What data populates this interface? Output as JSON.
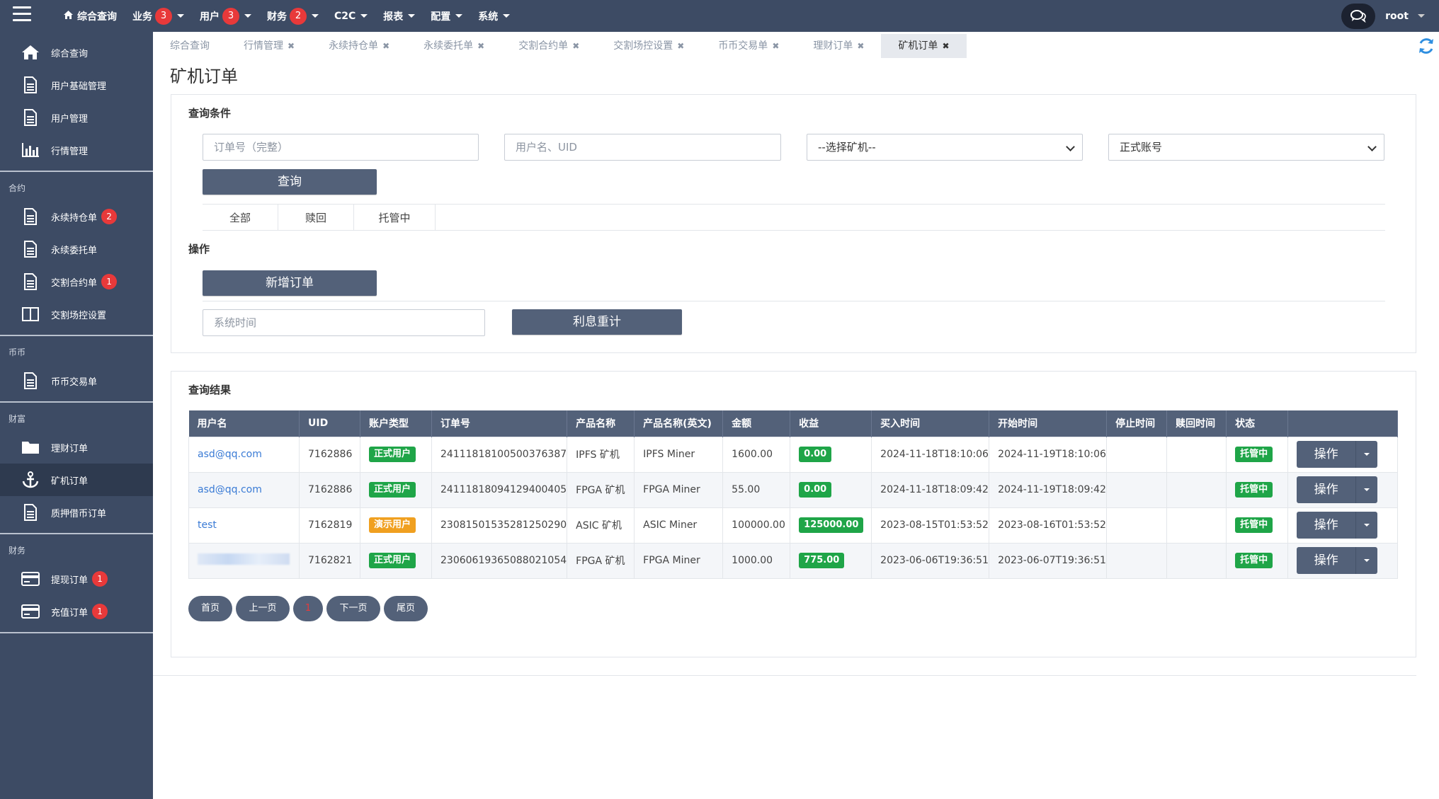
{
  "topnav": {
    "items": [
      {
        "label": "综合查询",
        "badge": ""
      },
      {
        "label": "业务",
        "badge": "3"
      },
      {
        "label": "用户",
        "badge": "3"
      },
      {
        "label": "财务",
        "badge": "2"
      },
      {
        "label": "C2C",
        "badge": ""
      },
      {
        "label": "报表",
        "badge": ""
      },
      {
        "label": "配置",
        "badge": ""
      },
      {
        "label": "系统",
        "badge": ""
      }
    ],
    "user": "root"
  },
  "sidebar": {
    "items": [
      {
        "label": "综合查询",
        "icon": "home-icon"
      },
      {
        "label": "用户基础管理",
        "icon": "document-icon"
      },
      {
        "label": "用户管理",
        "icon": "document-icon"
      },
      {
        "label": "行情管理",
        "icon": "bar-chart-icon"
      }
    ],
    "section_contract": "合约",
    "contract_items": [
      {
        "label": "永续持仓单",
        "badge": "2"
      },
      {
        "label": "永续委托单",
        "badge": ""
      },
      {
        "label": "交割合约单",
        "badge": "1"
      },
      {
        "label": "交割场控设置",
        "badge": ""
      }
    ],
    "section_coin": "币币",
    "coin_items": [
      {
        "label": "币币交易单"
      }
    ],
    "section_wealth": "财富",
    "wealth_items": [
      {
        "label": "理财订单"
      },
      {
        "label": "矿机订单"
      },
      {
        "label": "质押借币订单"
      }
    ],
    "section_finance": "财务",
    "finance_items": [
      {
        "label": "提现订单",
        "badge": "1"
      },
      {
        "label": "充值订单",
        "badge": "1"
      }
    ]
  },
  "tabs": [
    "综合查询",
    "行情管理",
    "永续持仓单",
    "永续委托单",
    "交割合约单",
    "交割场控设置",
    "币币交易单",
    "理财订单",
    "矿机订单"
  ],
  "page_title": "矿机订单",
  "query": {
    "heading": "查询条件",
    "order_placeholder": "订单号（完整）",
    "user_placeholder": "用户名、UID",
    "miner_select": "--选择矿机--",
    "account_select": "正式账号",
    "search_button": "查询",
    "subtabs": [
      "全部",
      "赎回",
      "托管中"
    ],
    "ops_heading": "操作",
    "add_button": "新增订单",
    "systime_placeholder": "系统时间",
    "recalc_button": "利息重计"
  },
  "results": {
    "heading": "查询结果",
    "columns": [
      "用户名",
      "UID",
      "账户类型",
      "订单号",
      "产品名称",
      "产品名称(英文)",
      "金额",
      "收益",
      "买入时间",
      "开始时间",
      "停止时间",
      "赎回时间",
      "状态",
      ""
    ],
    "rows": [
      {
        "user": "asd@qq.com",
        "uid": "7162886",
        "acct": "正式用户",
        "acct_type": "green",
        "order": "24111818100500376387",
        "product": "IPFS 矿机",
        "product_en": "IPFS Miner",
        "amount": "1600.00",
        "profit": "0.00",
        "buy": "2024-11-18T18:10:06",
        "start": "2024-11-19T18:10:06",
        "stop": "",
        "redeem": "",
        "status": "托管中"
      },
      {
        "user": "asd@qq.com",
        "uid": "7162886",
        "acct": "正式用户",
        "acct_type": "green",
        "order": "24111818094129400405",
        "product": "FPGA 矿机",
        "product_en": "FPGA Miner",
        "amount": "55.00",
        "profit": "0.00",
        "buy": "2024-11-18T18:09:42",
        "start": "2024-11-19T18:09:42",
        "stop": "",
        "redeem": "",
        "status": "托管中"
      },
      {
        "user": "test",
        "uid": "7162819",
        "acct": "演示用户",
        "acct_type": "orange",
        "order": "23081501535281250290",
        "product": "ASIC 矿机",
        "product_en": "ASIC Miner",
        "amount": "100000.00",
        "profit": "125000.00",
        "buy": "2023-08-15T01:53:52",
        "start": "2023-08-16T01:53:52",
        "stop": "",
        "redeem": "",
        "status": "托管中"
      },
      {
        "user": "",
        "uid": "7162821",
        "acct": "正式用户",
        "acct_type": "green",
        "order": "23060619365088021054",
        "product": "FPGA 矿机",
        "product_en": "FPGA Miner",
        "amount": "1000.00",
        "profit": "775.00",
        "buy": "2023-06-06T19:36:51",
        "start": "2023-06-07T19:36:51",
        "stop": "",
        "redeem": "",
        "status": "托管中"
      }
    ],
    "op_label": "操作"
  },
  "pager": [
    "首页",
    "上一页",
    "1",
    "下一页",
    "尾页"
  ],
  "colors": {
    "nav": "#3d4b64",
    "button": "#536179",
    "badge": "#e8393a",
    "green": "#1fa548",
    "orange": "#f0a020"
  }
}
